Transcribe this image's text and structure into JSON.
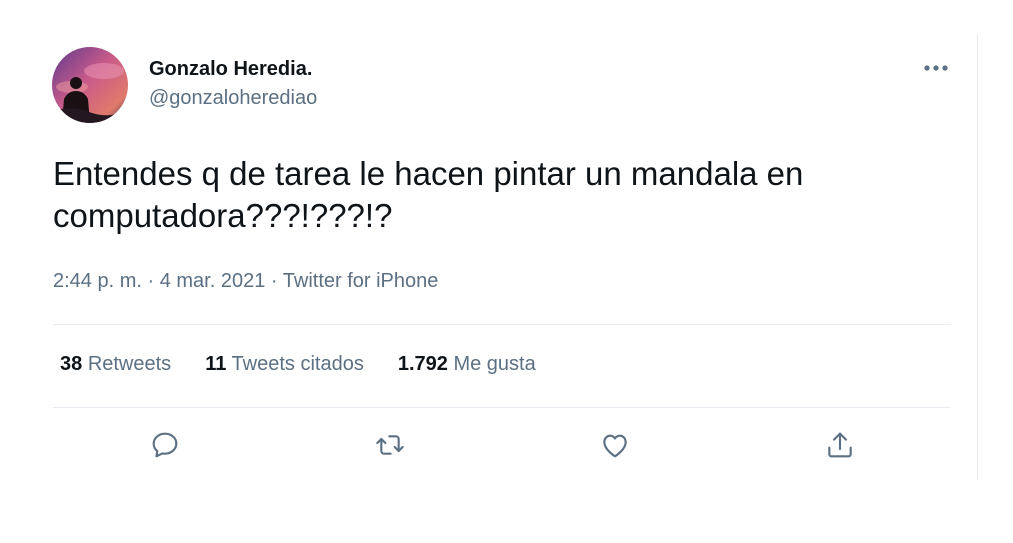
{
  "user": {
    "display_name": "Gonzalo Heredia.",
    "handle": "@gonzaloherediao",
    "avatar_icon": "profile-photo-silhouette-sunset"
  },
  "tweet": {
    "text": "Entendes q de tarea le hacen pintar un mandala en\ncomputadora???!???!?",
    "time": "2:44 p. m.",
    "date": "4 mar. 2021",
    "source": "Twitter for iPhone",
    "separator": " · "
  },
  "stats": {
    "retweets_count": "38",
    "retweets_label": "Retweets",
    "quotes_count": "11",
    "quotes_label": "Tweets citados",
    "likes_count": "1.792",
    "likes_label": "Me gusta"
  },
  "actions": [
    "reply-icon",
    "retweet-icon",
    "like-icon",
    "share-icon"
  ],
  "colors": {
    "text": "#0f1419",
    "secondary": "#5b7083",
    "border": "#e6ecf0"
  }
}
